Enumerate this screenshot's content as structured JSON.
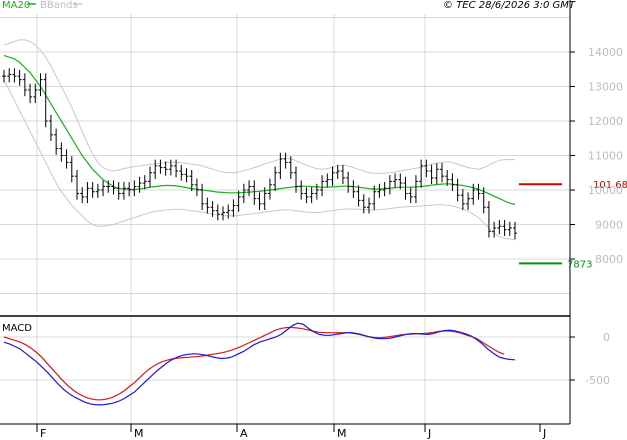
{
  "header": {
    "legend_ma": "MA20",
    "legend_bbands": "BBands",
    "copyright": "© TEC 28/6/2026 3:0 GMT"
  },
  "colors": {
    "ma": "#19b219",
    "bbands": "#c8c8c8",
    "price": "#000000",
    "resistance": "#cc0000",
    "support": "#009900",
    "macd": "#1a1ad8",
    "signal": "#d81a1a",
    "grid": "#d9d9d9",
    "frame": "#000000"
  },
  "chart_data": [
    {
      "type": "ohlc",
      "name": "price",
      "x_ticks": [
        "F",
        "M",
        "A",
        "M",
        "J",
        "J"
      ],
      "y_ticks": [
        8000,
        9000,
        10000,
        11000,
        12000,
        13000,
        14000
      ],
      "ylim": [
        6000,
        15000
      ],
      "levels": [
        {
          "label": "101 68",
          "value": 10168,
          "color": "resistance"
        },
        {
          "label": "7873",
          "value": 7873,
          "color": "support"
        }
      ],
      "series_price": [
        13300,
        13350,
        13300,
        13200,
        12900,
        12700,
        12900,
        13200,
        12000,
        11600,
        11200,
        11000,
        10800,
        10400,
        9900,
        9800,
        10050,
        9950,
        10000,
        10100,
        10100,
        10050,
        9900,
        10050,
        10000,
        10100,
        10200,
        10250,
        10500,
        10700,
        10650,
        10600,
        10700,
        10550,
        10450,
        10400,
        10150,
        10000,
        9600,
        9500,
        9400,
        9300,
        9350,
        9400,
        9550,
        9800,
        10000,
        10100,
        9750,
        9600,
        9900,
        10150,
        10500,
        10900,
        10800,
        10500,
        10100,
        9900,
        9800,
        9900,
        10000,
        10250,
        10300,
        10500,
        10550,
        10350,
        10100,
        9950,
        9700,
        9500,
        9600,
        9950,
        10000,
        10050,
        10250,
        10300,
        10200,
        9900,
        9800,
        10250,
        10700,
        10550,
        10350,
        10600,
        10400,
        10300,
        10150,
        9850,
        9600,
        9750,
        10000,
        9900,
        9500,
        8800,
        8900,
        8950,
        8850,
        8900,
        8750
      ],
      "series_ma20": [
        13900,
        13850,
        13800,
        13700,
        13550,
        13400,
        13200,
        13000,
        12750,
        12500,
        12250,
        12000,
        11750,
        11500,
        11250,
        11000,
        10800,
        10600,
        10450,
        10300,
        10200,
        10100,
        10050,
        10030,
        10020,
        10020,
        10030,
        10050,
        10080,
        10100,
        10120,
        10130,
        10130,
        10120,
        10100,
        10070,
        10040,
        10020,
        10000,
        9980,
        9960,
        9940,
        9930,
        9920,
        9920,
        9920,
        9930,
        9940,
        9950,
        9960,
        9980,
        10000,
        10020,
        10040,
        10060,
        10080,
        10100,
        10110,
        10110,
        10100,
        10090,
        10080,
        10080,
        10090,
        10100,
        10110,
        10110,
        10100,
        10080,
        10060,
        10040,
        10030,
        10030,
        10040,
        10050,
        10070,
        10080,
        10080,
        10080,
        10090,
        10100,
        10120,
        10140,
        10160,
        10170,
        10180,
        10170,
        10150,
        10130,
        10100,
        10070,
        10020,
        9960,
        9890,
        9820,
        9750,
        9680,
        9620,
        9580
      ],
      "series_bb_upper": [
        14200,
        14250,
        14300,
        14350,
        14350,
        14300,
        14200,
        14050,
        13850,
        13600,
        13300,
        13000,
        12700,
        12400,
        12050,
        11700,
        11350,
        11050,
        10800,
        10650,
        10580,
        10550,
        10580,
        10620,
        10650,
        10680,
        10700,
        10720,
        10740,
        10760,
        10780,
        10790,
        10800,
        10800,
        10790,
        10770,
        10750,
        10730,
        10700,
        10650,
        10600,
        10560,
        10520,
        10500,
        10500,
        10520,
        10560,
        10600,
        10650,
        10700,
        10760,
        10800,
        10850,
        10900,
        10920,
        10900,
        10850,
        10780,
        10720,
        10660,
        10620,
        10600,
        10620,
        10660,
        10700,
        10720,
        10700,
        10650,
        10600,
        10550,
        10500,
        10480,
        10480,
        10490,
        10500,
        10520,
        10550,
        10580,
        10600,
        10630,
        10660,
        10700,
        10750,
        10780,
        10800,
        10820,
        10800,
        10750,
        10700,
        10650,
        10620,
        10600,
        10650,
        10720,
        10800,
        10860,
        10880,
        10880,
        10880
      ],
      "series_bb_lower": [
        13200,
        12900,
        12600,
        12300,
        12000,
        11700,
        11400,
        11100,
        10800,
        10500,
        10200,
        9950,
        9750,
        9550,
        9400,
        9250,
        9100,
        9000,
        8950,
        8950,
        8970,
        9000,
        9050,
        9100,
        9150,
        9200,
        9250,
        9300,
        9350,
        9380,
        9400,
        9420,
        9430,
        9440,
        9440,
        9420,
        9400,
        9380,
        9360,
        9330,
        9300,
        9280,
        9260,
        9250,
        9250,
        9260,
        9280,
        9300,
        9320,
        9340,
        9360,
        9380,
        9400,
        9420,
        9430,
        9420,
        9400,
        9380,
        9360,
        9350,
        9350,
        9360,
        9380,
        9400,
        9420,
        9440,
        9450,
        9450,
        9440,
        9430,
        9420,
        9420,
        9430,
        9440,
        9460,
        9480,
        9500,
        9510,
        9520,
        9530,
        9540,
        9550,
        9560,
        9570,
        9570,
        9560,
        9540,
        9500,
        9450,
        9380,
        9300,
        9200,
        9050,
        8900,
        8750,
        8650,
        8600,
        8580,
        8560
      ]
    },
    {
      "type": "line",
      "name": "MACD",
      "title": "MACD",
      "y_ticks": [
        0,
        -500
      ],
      "ylim": [
        -950,
        250
      ],
      "series_macd": [
        -60,
        -80,
        -110,
        -140,
        -190,
        -240,
        -290,
        -350,
        -410,
        -480,
        -550,
        -610,
        -660,
        -700,
        -730,
        -760,
        -780,
        -790,
        -790,
        -780,
        -770,
        -750,
        -720,
        -680,
        -640,
        -580,
        -520,
        -460,
        -400,
        -350,
        -300,
        -260,
        -230,
        -210,
        -200,
        -195,
        -200,
        -210,
        -225,
        -240,
        -250,
        -245,
        -230,
        -200,
        -170,
        -130,
        -90,
        -60,
        -40,
        -20,
        0,
        30,
        80,
        130,
        160,
        150,
        100,
        60,
        30,
        20,
        20,
        30,
        40,
        50,
        50,
        40,
        25,
        5,
        -10,
        -20,
        -20,
        -15,
        0,
        15,
        30,
        40,
        40,
        35,
        30,
        40,
        60,
        75,
        80,
        70,
        55,
        35,
        10,
        -30,
        -80,
        -140,
        -190,
        -230,
        -250,
        -260,
        -265
      ],
      "series_signal": [
        0,
        -20,
        -40,
        -60,
        -90,
        -130,
        -180,
        -240,
        -310,
        -380,
        -450,
        -520,
        -580,
        -630,
        -670,
        -700,
        -720,
        -730,
        -730,
        -720,
        -700,
        -670,
        -630,
        -580,
        -530,
        -470,
        -410,
        -360,
        -320,
        -290,
        -270,
        -255,
        -245,
        -240,
        -235,
        -230,
        -225,
        -215,
        -205,
        -195,
        -185,
        -170,
        -150,
        -125,
        -100,
        -70,
        -40,
        -10,
        20,
        50,
        80,
        100,
        110,
        110,
        105,
        95,
        80,
        65,
        55,
        50,
        50,
        50,
        50,
        50,
        45,
        35,
        20,
        5,
        -5,
        -10,
        -5,
        5,
        15,
        25,
        30,
        35,
        40,
        40,
        45,
        55,
        65,
        70,
        70,
        60,
        45,
        25,
        5,
        -20,
        -60,
        -100,
        -140,
        -175,
        -200
      ]
    }
  ]
}
